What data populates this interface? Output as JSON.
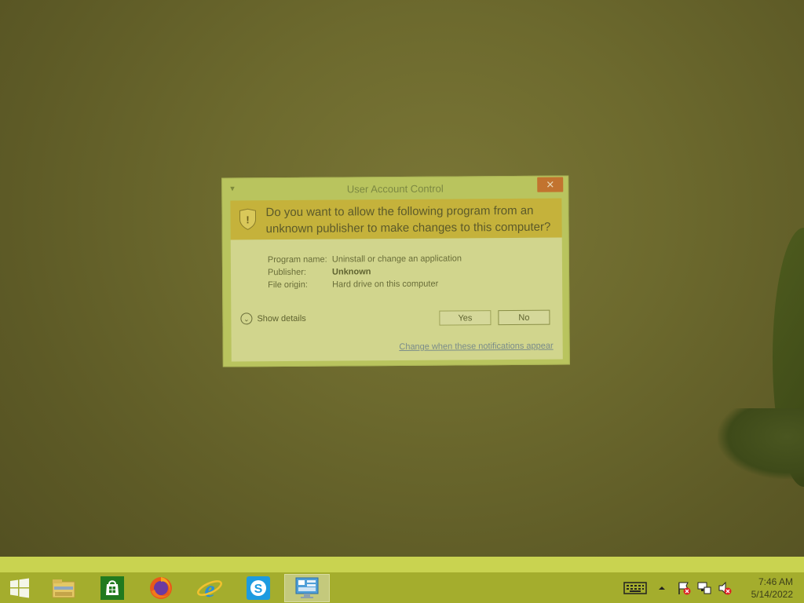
{
  "dialog": {
    "title": "User Account Control",
    "close_label": "✕",
    "question": "Do you want to allow the following program from an unknown publisher to make changes to this computer?",
    "details": [
      {
        "key": "Program name:",
        "value": "Uninstall or change an application",
        "bold": false
      },
      {
        "key": "Publisher:",
        "value": "Unknown",
        "bold": true
      },
      {
        "key": "File origin:",
        "value": "Hard drive on this computer",
        "bold": false
      }
    ],
    "show_details_label": "Show details",
    "yes_label": "Yes",
    "no_label": "No",
    "notifications_link": "Change when these notifications appear"
  },
  "taskbar": {
    "items": [
      {
        "name": "start-button",
        "icon": "windows-logo-icon"
      },
      {
        "name": "file-explorer",
        "icon": "folder-icon"
      },
      {
        "name": "store",
        "icon": "store-bag-icon"
      },
      {
        "name": "firefox",
        "icon": "firefox-icon"
      },
      {
        "name": "internet-explorer",
        "icon": "ie-icon"
      },
      {
        "name": "skype",
        "icon": "skype-icon"
      },
      {
        "name": "uac-window",
        "icon": "control-panel-icon",
        "active": true
      }
    ],
    "tray": {
      "icons": [
        "keyboard-icon",
        "chevron-up-icon",
        "action-center-flag-icon",
        "network-icon",
        "volume-muted-icon"
      ]
    },
    "clock": {
      "time": "7:46 AM",
      "date": "5/14/2022"
    }
  }
}
